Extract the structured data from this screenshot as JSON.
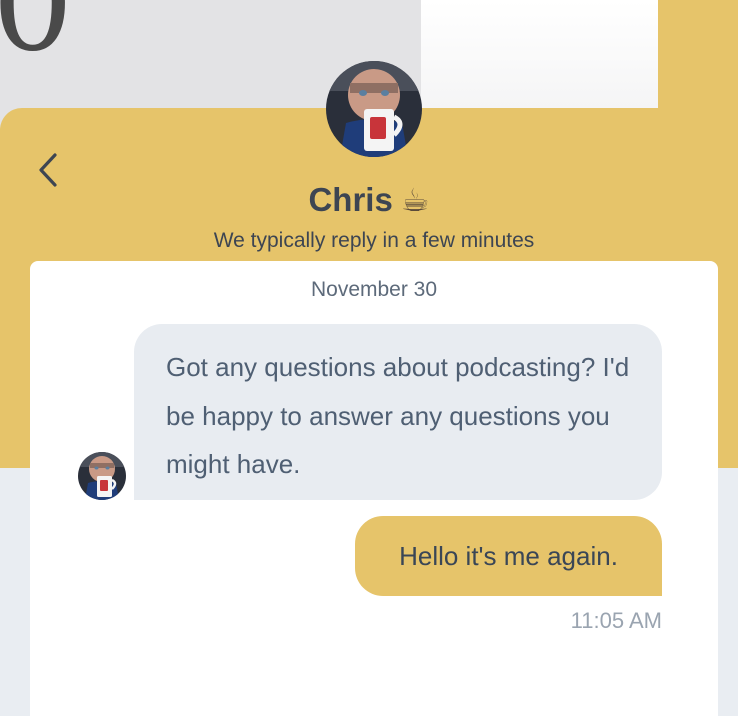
{
  "background": {
    "glyph": "0"
  },
  "header": {
    "back_icon": "chevron-left-icon",
    "agent_name": "Chris",
    "agent_emoji": "☕",
    "reply_time": "We typically reply in a few minutes"
  },
  "conversation": {
    "date": "November 30",
    "messages": [
      {
        "direction": "incoming",
        "text": "Got any questions about podcasting? I'd be happy to answer any questions you might have."
      },
      {
        "direction": "outgoing",
        "text": "Hello it's me again.",
        "time": "11:05 AM"
      }
    ]
  },
  "colors": {
    "accent": "#e6c46a",
    "incoming_bubble": "#e8ecf1",
    "text_dark": "#3d4552"
  }
}
